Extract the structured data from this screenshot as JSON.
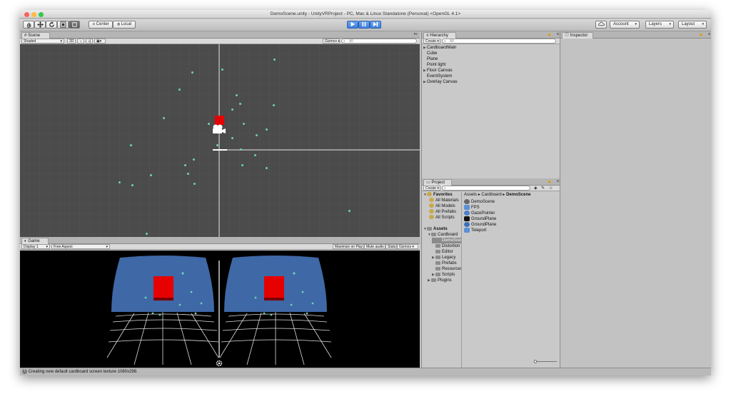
{
  "window": {
    "title": "DemoScene.unity - UnityVRProject - PC, Mac & Linux Standalone (Personal) <OpenGL 4.1>"
  },
  "toolbar": {
    "transform_tools": [
      "hand-icon",
      "move-icon",
      "rotate-icon",
      "scale-icon",
      "rect-icon"
    ],
    "pivot_label": "Center",
    "space_label": "Local",
    "play_icons": [
      "play-icon",
      "pause-icon",
      "step-icon"
    ],
    "account_label": "Account",
    "layers_label": "Layers",
    "layout_label": "Layout"
  },
  "scene": {
    "tab_label": "Scene",
    "shading_mode": "Shaded",
    "mode_2d": "2D",
    "gizmos_label": "Gizmos",
    "search_placeholder": "All"
  },
  "game": {
    "tab_label": "Game",
    "display_label": "Display 1",
    "aspect_label": "Free Aspect",
    "maximize_label": "Maximize on Play",
    "mute_label": "Mute audio",
    "stats_label": "Stats",
    "gizmos_label": "Gizmos"
  },
  "hierarchy": {
    "tab_label": "Hierarchy",
    "create_label": "Create",
    "search_placeholder": "All",
    "items": [
      {
        "label": "CardboardMain",
        "expandable": true
      },
      {
        "label": "Cube",
        "expandable": false
      },
      {
        "label": "Plane",
        "expandable": false
      },
      {
        "label": "Point light",
        "expandable": false
      },
      {
        "label": "Floor Canvas",
        "expandable": true
      },
      {
        "label": "EventSystem",
        "expandable": false
      },
      {
        "label": "Overlay Canvas",
        "expandable": true
      }
    ]
  },
  "project": {
    "tab_label": "Project",
    "create_label": "Create",
    "favorites_label": "Favorites",
    "favorites": [
      "All Materials",
      "All Models",
      "All Prefabs",
      "All Scripts"
    ],
    "assets_label": "Assets",
    "tree": [
      {
        "label": "Cardboard",
        "depth": 1,
        "expandable": true
      },
      {
        "label": "DemoScene",
        "depth": 2,
        "expandable": false,
        "selected": true
      },
      {
        "label": "Distortion",
        "depth": 2,
        "expandable": false
      },
      {
        "label": "Editor",
        "depth": 2,
        "expandable": false
      },
      {
        "label": "Legacy",
        "depth": 2,
        "expandable": true
      },
      {
        "label": "Prefabs",
        "depth": 2,
        "expandable": false
      },
      {
        "label": "Resources",
        "depth": 2,
        "expandable": false
      },
      {
        "label": "Scripts",
        "depth": 2,
        "expandable": true
      },
      {
        "label": "Plugins",
        "depth": 1,
        "expandable": true
      }
    ],
    "breadcrumb": [
      "Assets",
      "Cardboard",
      "DemoScene"
    ],
    "files": [
      {
        "label": "DemoScene",
        "icon": "unity-scene-icon"
      },
      {
        "label": "FPS",
        "icon": "script-icon"
      },
      {
        "label": "GazePointer",
        "icon": "prefab-icon"
      },
      {
        "label": "GroundPlane",
        "icon": "texture-icon"
      },
      {
        "label": "GroundPlane",
        "icon": "material-icon"
      },
      {
        "label": "Teleport",
        "icon": "script-icon"
      }
    ]
  },
  "inspector": {
    "tab_label": "Inspector"
  },
  "status": {
    "message": "Creating new default cardboard screen texture 1080x298."
  },
  "colors": {
    "accent_play": "#4a8ee8",
    "cube": "#e60000",
    "sky": "#3f68a6",
    "particle": "#6fd0b5"
  }
}
